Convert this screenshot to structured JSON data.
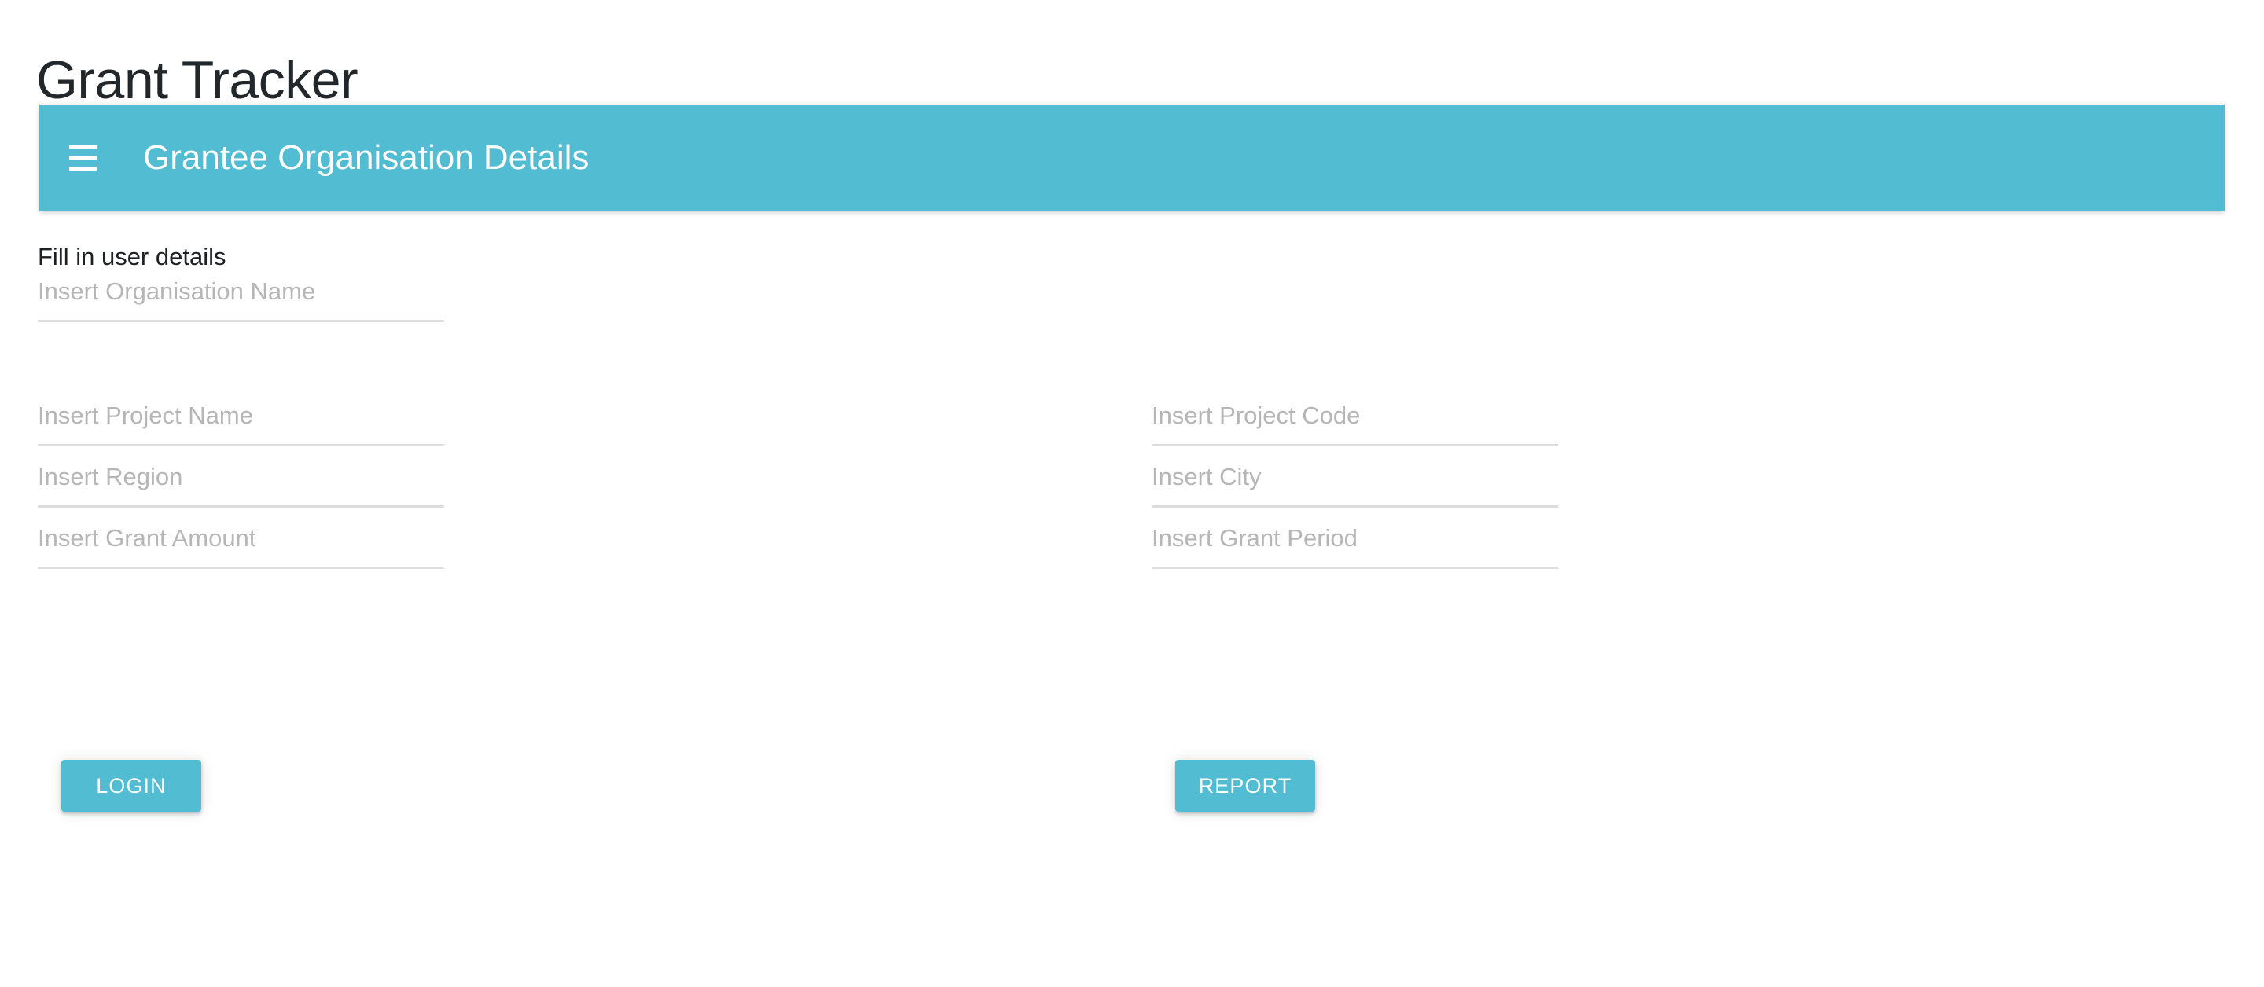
{
  "page": {
    "title": "Grant Tracker"
  },
  "toolbar": {
    "menu_icon": "hamburger-menu-icon",
    "title": "Grantee Organisation Details",
    "background_color": "#51bcd2"
  },
  "form": {
    "section_label": "Fill in user details",
    "fields": [
      {
        "name": "organisation-name",
        "placeholder": "Insert Organisation Name",
        "value": "",
        "column": "left",
        "row": 1
      },
      {
        "name": "project-name",
        "placeholder": "Insert Project Name",
        "value": "",
        "column": "left",
        "row": 2
      },
      {
        "name": "project-code",
        "placeholder": "Insert Project Code",
        "value": "",
        "column": "right",
        "row": 2
      },
      {
        "name": "region",
        "placeholder": "Insert Region",
        "value": "",
        "column": "left",
        "row": 3
      },
      {
        "name": "city",
        "placeholder": "Insert City",
        "value": "",
        "column": "right",
        "row": 3
      },
      {
        "name": "grant-amount",
        "placeholder": "Insert Grant Amount",
        "value": "",
        "column": "left",
        "row": 4
      },
      {
        "name": "grant-period",
        "placeholder": "Insert Grant Period",
        "value": "",
        "column": "right",
        "row": 4
      }
    ]
  },
  "actions": {
    "login_label": "LOGIN",
    "report_label": "REPORT",
    "button_color": "#51bcd2",
    "button_text_color": "#ffffff"
  },
  "colors": {
    "accent": "#51bcd2",
    "text": "#1d2023",
    "placeholder": "#b6b6b6",
    "underline": "#dedede",
    "background": "#ffffff"
  }
}
